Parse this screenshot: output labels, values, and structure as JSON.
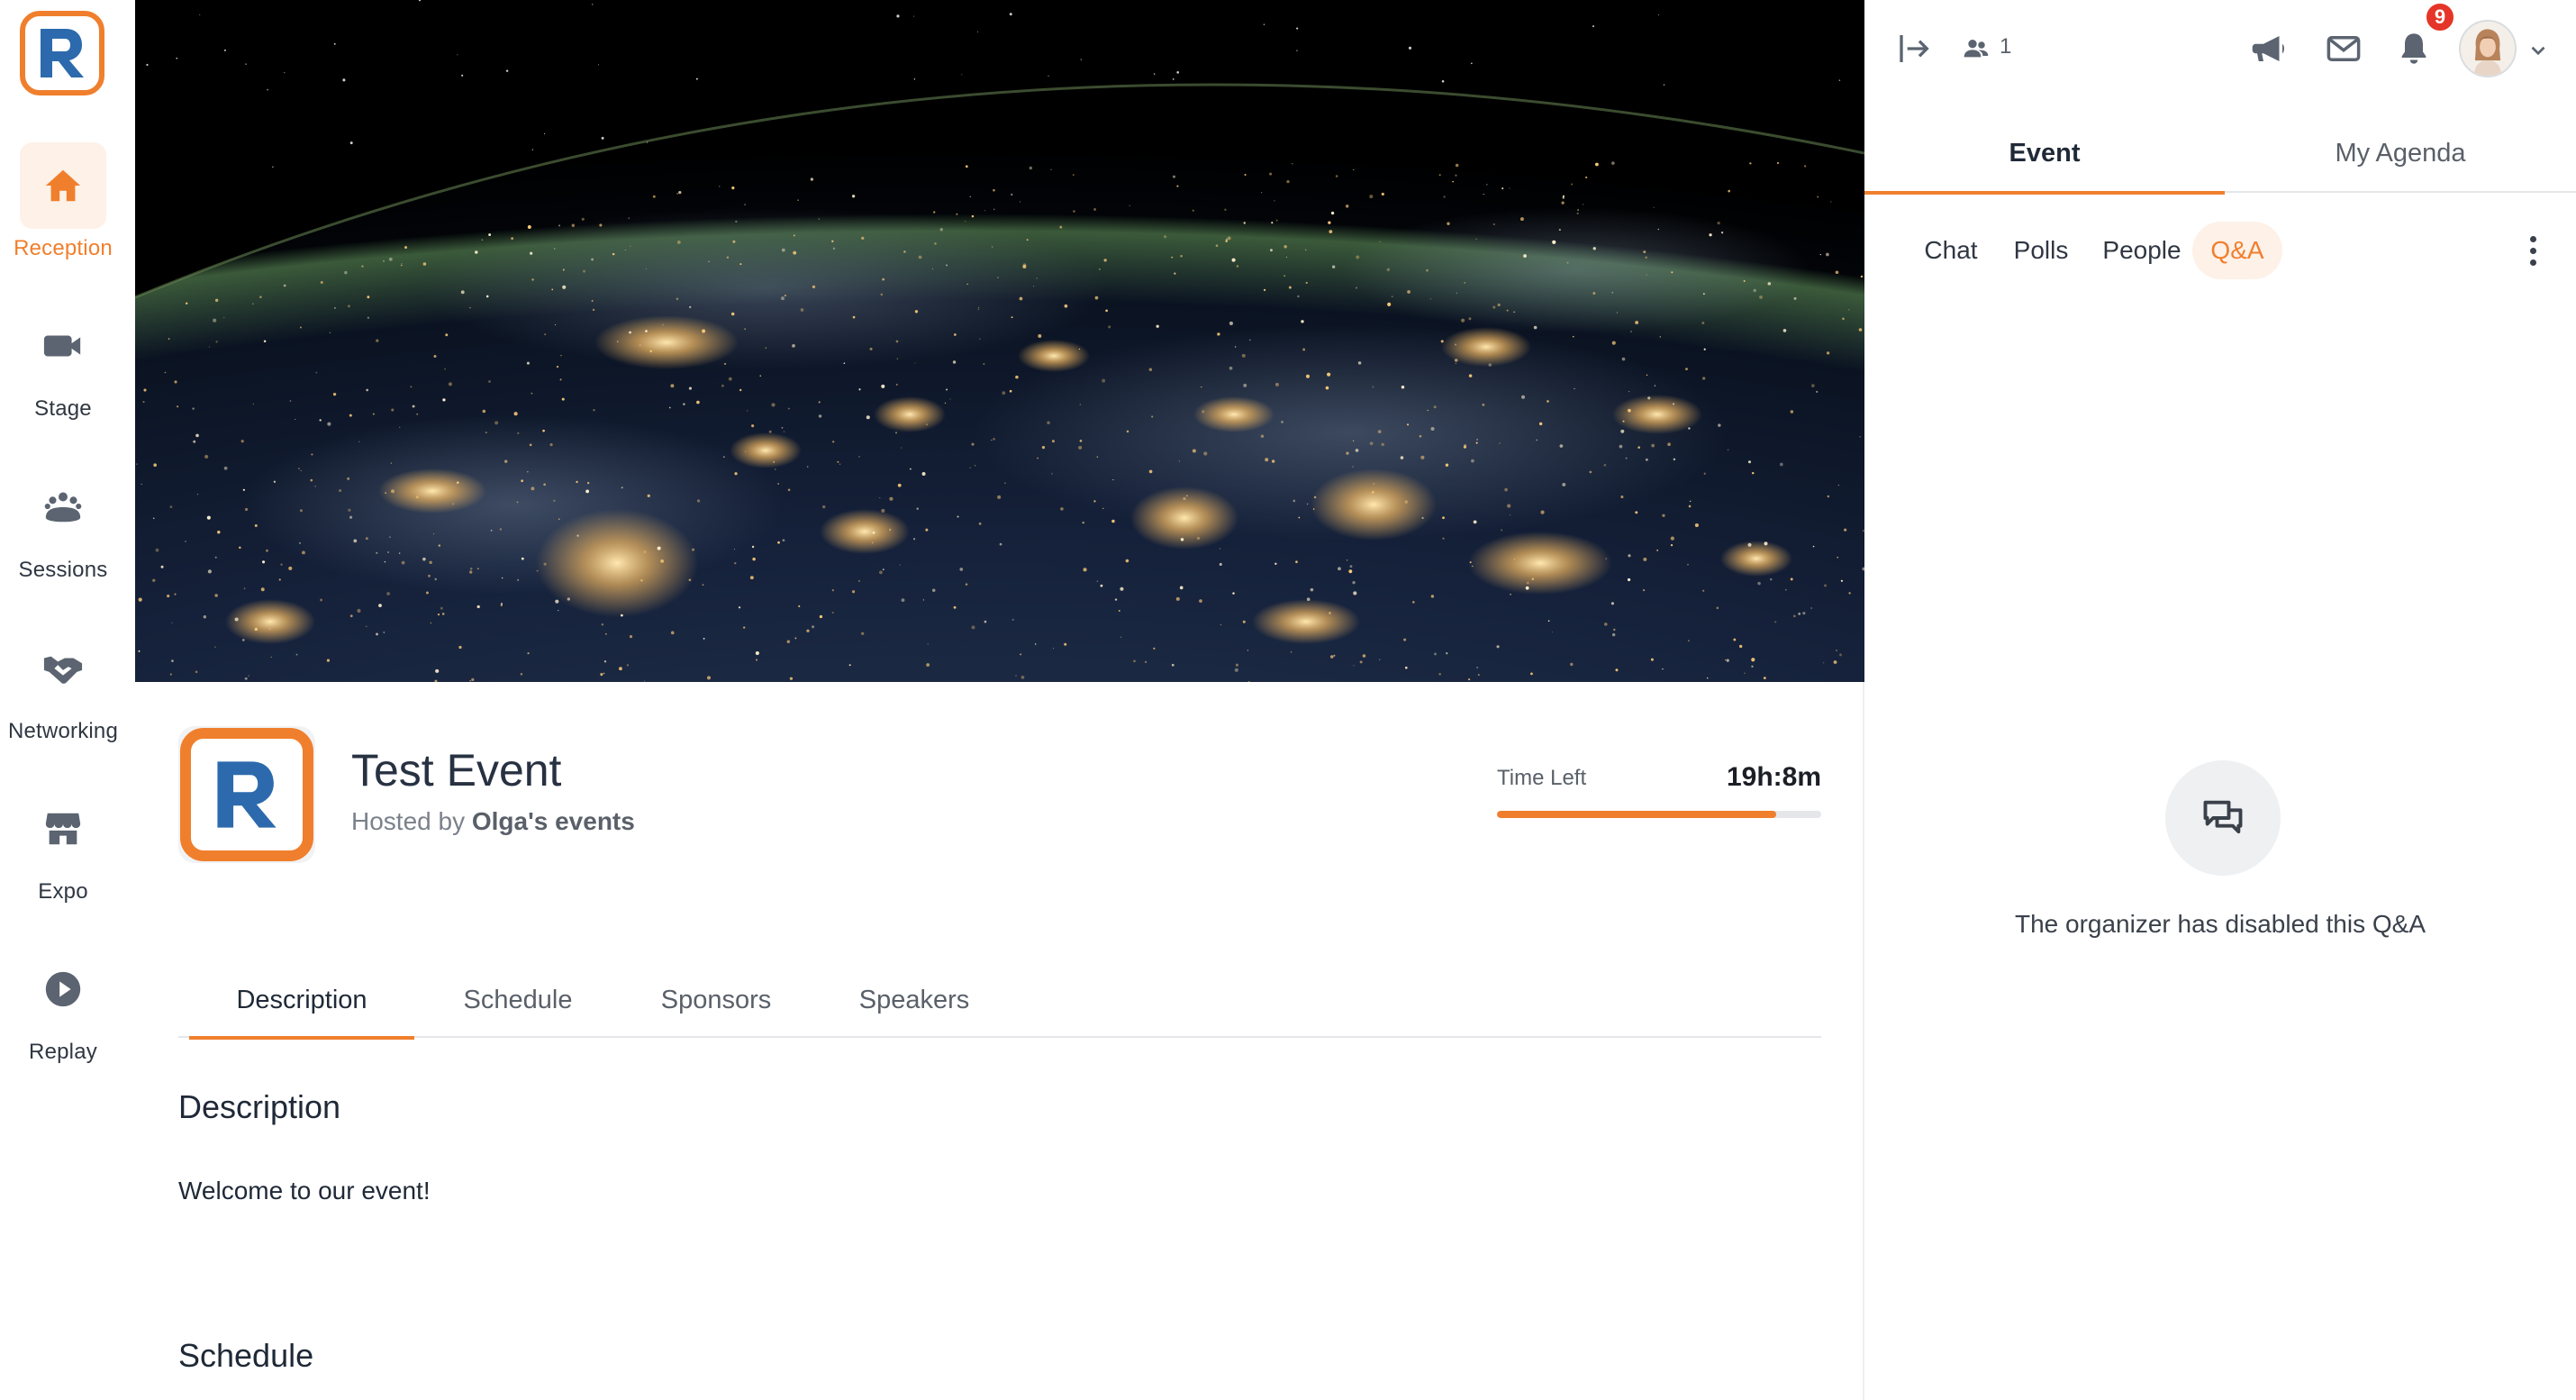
{
  "colors": {
    "accent": "#f07f2d",
    "accent_soft": "#fdf1e8",
    "badge": "#e53528",
    "text": "#1f2937",
    "muted": "#5a6069"
  },
  "nav": {
    "items": [
      {
        "label": "Reception",
        "icon": "home-icon",
        "active": true
      },
      {
        "label": "Stage",
        "icon": "video-camera-icon",
        "active": false
      },
      {
        "label": "Sessions",
        "icon": "group-icon",
        "active": false
      },
      {
        "label": "Networking",
        "icon": "handshake-icon",
        "active": false
      },
      {
        "label": "Expo",
        "icon": "storefront-icon",
        "active": false
      },
      {
        "label": "Replay",
        "icon": "play-circle-icon",
        "active": false
      }
    ]
  },
  "event": {
    "title": "Test Event",
    "hosted_prefix": "Hosted by",
    "host_name": "Olga's events",
    "time_left_label": "Time Left",
    "time_left_value": "19h:8m",
    "time_left_progress": 0.86
  },
  "tabs": [
    {
      "label": "Description",
      "active": true
    },
    {
      "label": "Schedule",
      "active": false
    },
    {
      "label": "Sponsors",
      "active": false
    },
    {
      "label": "Speakers",
      "active": false
    }
  ],
  "content": {
    "description_heading": "Description",
    "description_text": "Welcome to our event!",
    "schedule_heading": "Schedule"
  },
  "right_panel": {
    "online_count": "1",
    "notification_count": "9",
    "tabs": [
      {
        "label": "Event",
        "active": true
      },
      {
        "label": "My Agenda",
        "active": false
      }
    ],
    "subtabs": [
      {
        "label": "Chat",
        "active": false
      },
      {
        "label": "Polls",
        "active": false
      },
      {
        "label": "People",
        "active": false
      },
      {
        "label": "Q&A",
        "active": true
      }
    ],
    "qa_disabled_text": "The organizer has disabled this Q&A"
  }
}
